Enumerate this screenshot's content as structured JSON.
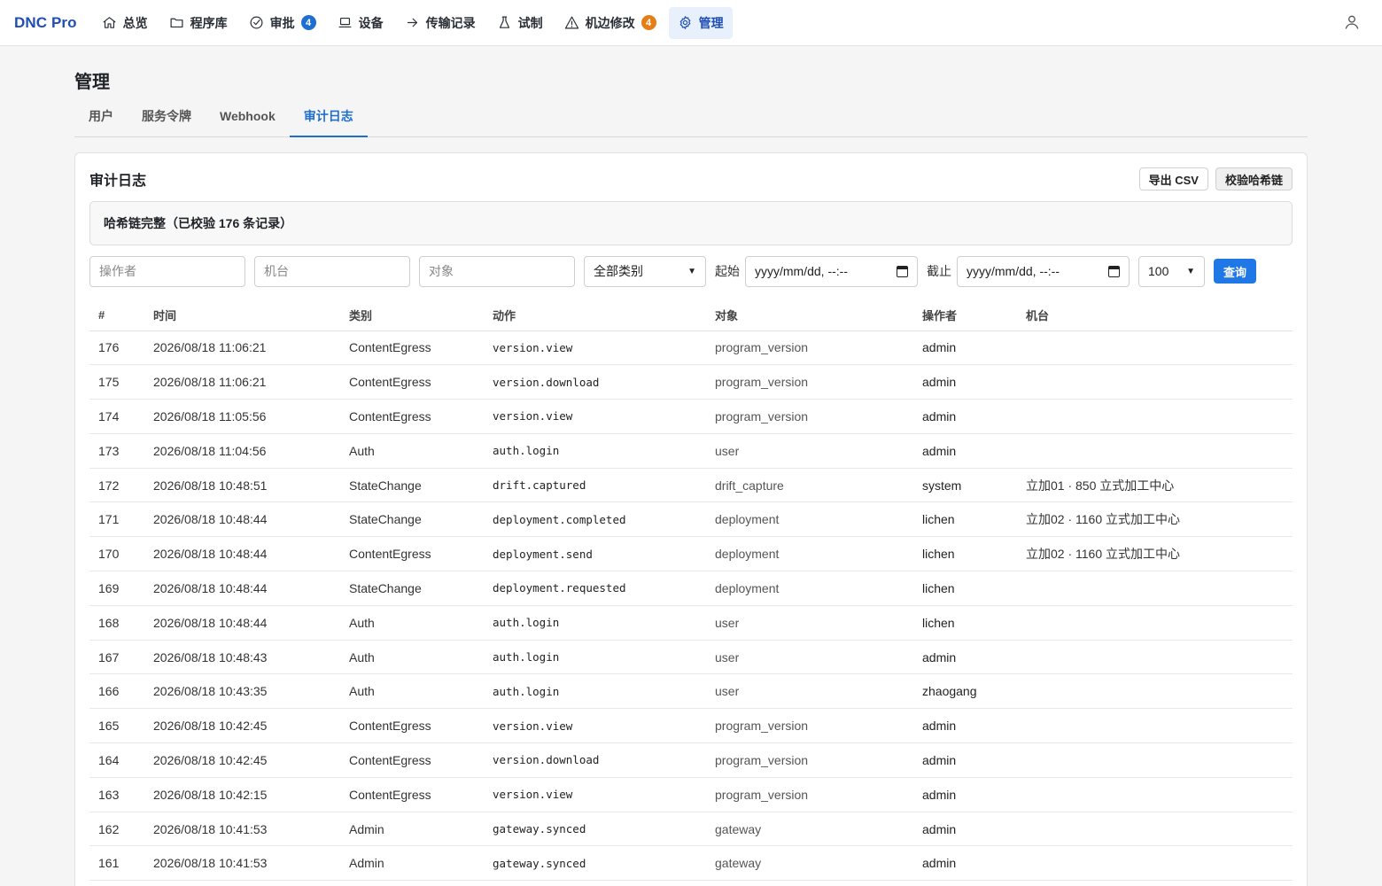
{
  "brand": "DNC Pro",
  "nav": [
    {
      "label": "总览",
      "icon": "home-icon"
    },
    {
      "label": "程序库",
      "icon": "folder-icon"
    },
    {
      "label": "审批",
      "icon": "check-circle-icon",
      "badge": "4",
      "badge_color": "#1f6fd1"
    },
    {
      "label": "设备",
      "icon": "laptop-icon"
    },
    {
      "label": "传输记录",
      "icon": "arrow-right-icon"
    },
    {
      "label": "试制",
      "icon": "flask-icon"
    },
    {
      "label": "机边修改",
      "icon": "warning-icon",
      "badge": "4",
      "badge_color": "#e67e17"
    },
    {
      "label": "管理",
      "icon": "gear-icon",
      "active": true
    }
  ],
  "page": {
    "title": "管理",
    "tabs": [
      "用户",
      "服务令牌",
      "Webhook",
      "审计日志"
    ],
    "active_tab": "审计日志"
  },
  "card": {
    "title": "审计日志",
    "export_label": "导出 CSV",
    "verify_label": "校验哈希链",
    "notice": "哈希链完整（已校验 176 条记录）"
  },
  "filters": {
    "actor_placeholder": "操作者",
    "machine_placeholder": "机台",
    "object_placeholder": "对象",
    "category_value": "全部类别",
    "start_label": "起始",
    "start_value": "yyyy/mm/dd, --:--",
    "end_label": "截止",
    "end_value": "yyyy/mm/dd, --:--",
    "limit_value": "100",
    "query_label": "查询"
  },
  "table": {
    "headers": [
      "#",
      "时间",
      "类别",
      "动作",
      "对象",
      "操作者",
      "机台"
    ],
    "rows": [
      [
        "176",
        "2026/08/18 11:06:21",
        "ContentEgress",
        "version.view",
        "program_version",
        "admin",
        ""
      ],
      [
        "175",
        "2026/08/18 11:06:21",
        "ContentEgress",
        "version.download",
        "program_version",
        "admin",
        ""
      ],
      [
        "174",
        "2026/08/18 11:05:56",
        "ContentEgress",
        "version.view",
        "program_version",
        "admin",
        ""
      ],
      [
        "173",
        "2026/08/18 11:04:56",
        "Auth",
        "auth.login",
        "user",
        "admin",
        ""
      ],
      [
        "172",
        "2026/08/18 10:48:51",
        "StateChange",
        "drift.captured",
        "drift_capture",
        "system",
        "立加01 · 850 立式加工中心"
      ],
      [
        "171",
        "2026/08/18 10:48:44",
        "StateChange",
        "deployment.completed",
        "deployment",
        "lichen",
        "立加02 · 1160 立式加工中心"
      ],
      [
        "170",
        "2026/08/18 10:48:44",
        "ContentEgress",
        "deployment.send",
        "deployment",
        "lichen",
        "立加02 · 1160 立式加工中心"
      ],
      [
        "169",
        "2026/08/18 10:48:44",
        "StateChange",
        "deployment.requested",
        "deployment",
        "lichen",
        ""
      ],
      [
        "168",
        "2026/08/18 10:48:44",
        "Auth",
        "auth.login",
        "user",
        "lichen",
        ""
      ],
      [
        "167",
        "2026/08/18 10:48:43",
        "Auth",
        "auth.login",
        "user",
        "admin",
        ""
      ],
      [
        "166",
        "2026/08/18 10:43:35",
        "Auth",
        "auth.login",
        "user",
        "zhaogang",
        ""
      ],
      [
        "165",
        "2026/08/18 10:42:45",
        "ContentEgress",
        "version.view",
        "program_version",
        "admin",
        ""
      ],
      [
        "164",
        "2026/08/18 10:42:45",
        "ContentEgress",
        "version.download",
        "program_version",
        "admin",
        ""
      ],
      [
        "163",
        "2026/08/18 10:42:15",
        "ContentEgress",
        "version.view",
        "program_version",
        "admin",
        ""
      ],
      [
        "162",
        "2026/08/18 10:41:53",
        "Admin",
        "gateway.synced",
        "gateway",
        "admin",
        ""
      ],
      [
        "161",
        "2026/08/18 10:41:53",
        "Admin",
        "gateway.synced",
        "gateway",
        "admin",
        ""
      ]
    ]
  }
}
